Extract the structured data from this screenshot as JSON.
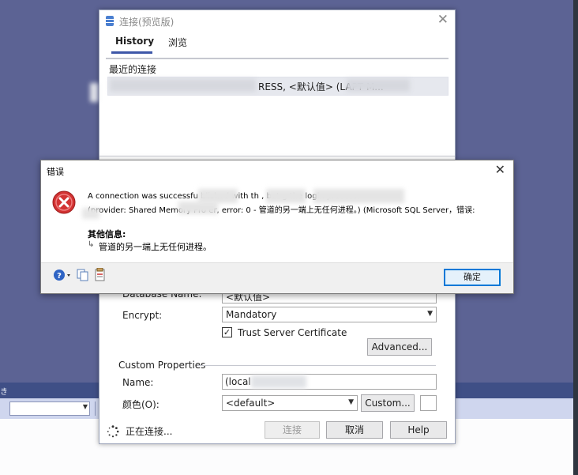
{
  "connect_dialog": {
    "title": "连接(预览版)",
    "tabs": [
      "History",
      "浏览"
    ],
    "recent_label": "最近的连接",
    "recent_item_text": "RESS, <默认值> (LAPT M...",
    "database_name_label": "Database Name:",
    "database_name_value": "<默认值>",
    "encrypt_label": "Encrypt:",
    "encrypt_value": "Mandatory",
    "trust_label": "Trust Server Certificate",
    "trust_checked": "✓",
    "advanced_button": "Advanced...",
    "custom_properties_label": "Custom Properties",
    "name_label": "Name:",
    "name_value": "(local",
    "color_label": "颜色(O):",
    "color_value": "<default>",
    "custom_button": "Custom...",
    "status_text": "正在连接...",
    "connect_button": "连接",
    "cancel_button": "取消",
    "help_button": "Help"
  },
  "error_dialog": {
    "title": "错误",
    "message_line1": "A connection was successfu      blished with th         , but                                        g the login process.",
    "message_line2": "(provider: Shared Memory Pro     er, error: 0 - 管道的另一端上无任何进程。) (Microsoft SQL Server，错误:",
    "more_info_label": "其他信息:",
    "more_info_arrow": "↳",
    "more_info_text": "管道的另一端上无任何进程。",
    "ok_button": "确定"
  },
  "background": {
    "strip_text": "き"
  },
  "colors": {
    "accent": "#3d57a8",
    "error_red": "#d23232",
    "background": "#5c6394"
  },
  "icons": [
    "database-icon",
    "close-icon",
    "error-icon",
    "help-icon",
    "copy-icon",
    "details-icon",
    "spinner-icon"
  ]
}
